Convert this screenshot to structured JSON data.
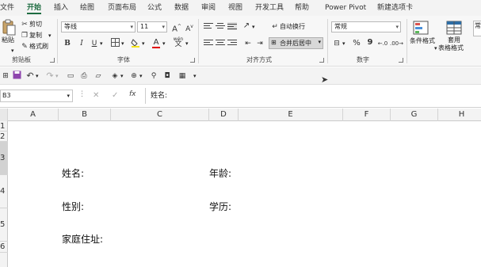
{
  "menu": {
    "tabs": [
      {
        "label": "文件"
      },
      {
        "label": "开始"
      },
      {
        "label": "插入"
      },
      {
        "label": "绘图"
      },
      {
        "label": "页面布局"
      },
      {
        "label": "公式"
      },
      {
        "label": "数据"
      },
      {
        "label": "审阅"
      },
      {
        "label": "视图"
      },
      {
        "label": "开发工具"
      },
      {
        "label": "帮助"
      },
      {
        "label": "Power Pivot"
      },
      {
        "label": "新建选项卡"
      }
    ],
    "active_tab": "开始"
  },
  "ribbon": {
    "clipboard": {
      "paste_label": "粘贴",
      "cut_label": "剪切",
      "copy_label": "复制",
      "format_painter_label": "格式刷",
      "group_label": "剪贴板"
    },
    "font": {
      "font_name": "等线",
      "font_size": "11",
      "group_label": "字体",
      "bold": "B",
      "italic": "I",
      "underline": "U",
      "grow": "A",
      "shrink": "A",
      "font_color": "A",
      "wen": "wén"
    },
    "alignment": {
      "wrap_label": "自动换行",
      "merge_label": "合并后居中",
      "group_label": "对齐方式"
    },
    "number": {
      "format": "常规",
      "percent": "%",
      "comma": "9",
      "group_label": "数字"
    },
    "styles": {
      "conditional_label": "条件格式",
      "table_label_1": "套用",
      "table_label_2": "表格格式",
      "cell_style_label": "常"
    }
  },
  "formula_bar": {
    "name_box": "B3",
    "cancel": "✕",
    "enter": "✓",
    "fx": "fx",
    "content": "姓名:"
  },
  "grid": {
    "columns": [
      "A",
      "B",
      "C",
      "D",
      "E",
      "F",
      "G",
      "H"
    ],
    "rows": [
      "1",
      "2",
      "3",
      "4",
      "5",
      "6"
    ],
    "cells": {
      "b3": "姓名:",
      "d3": "年龄:",
      "b4": "性别:",
      "d4": "学历:",
      "b5": "家庭住址:"
    }
  },
  "colors": {
    "accent": "#1e6c41"
  }
}
